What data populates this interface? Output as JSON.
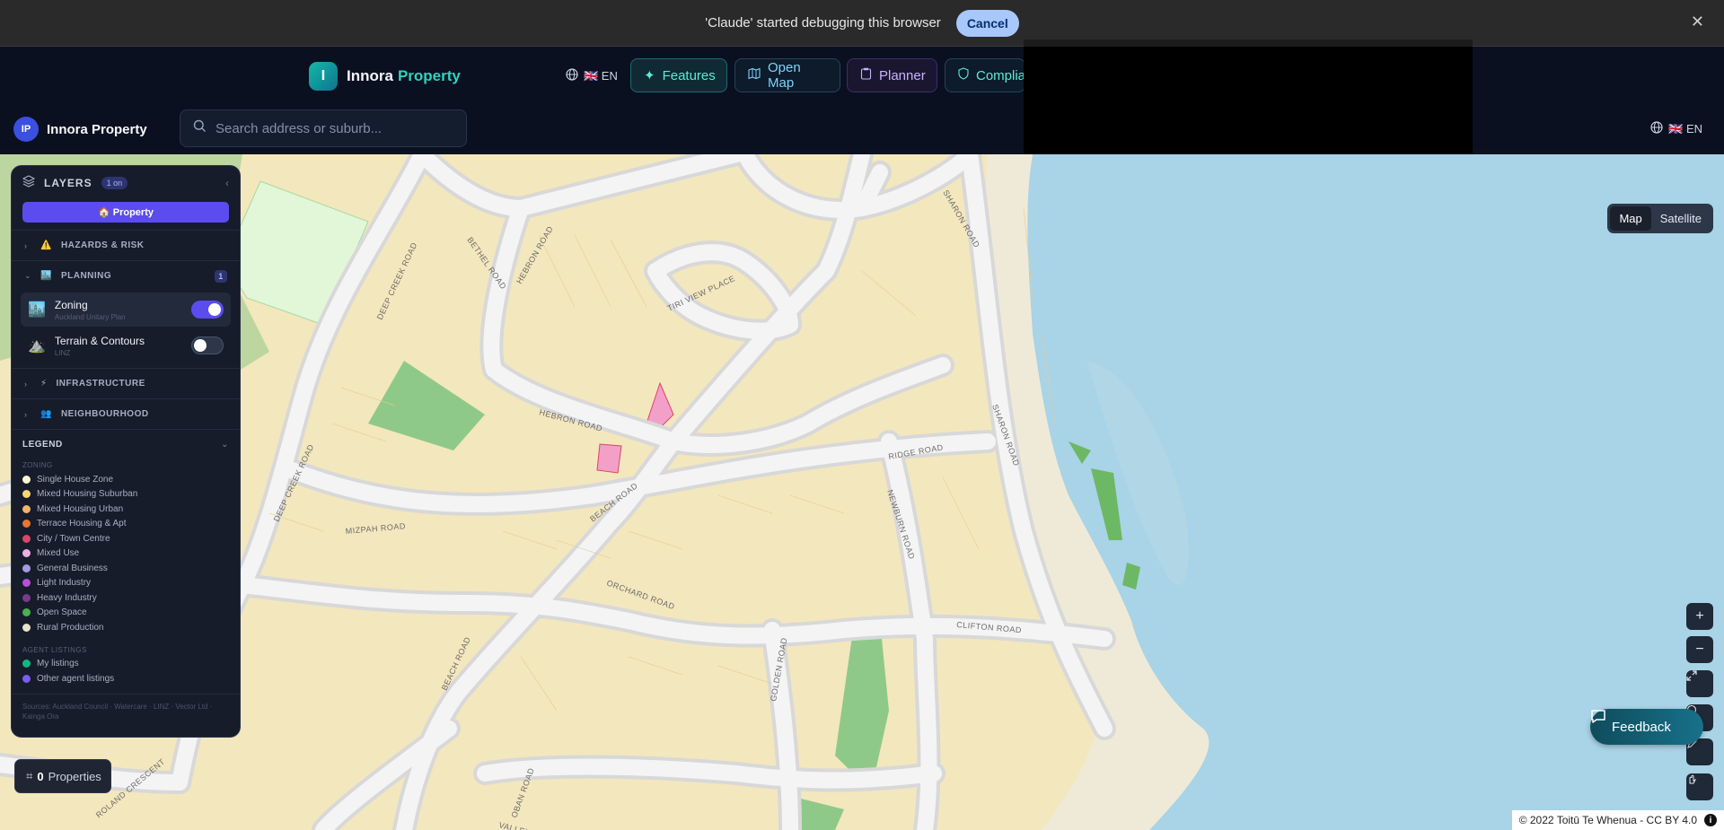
{
  "debug_banner": {
    "message": "'Claude' started debugging this browser",
    "cancel_label": "Cancel"
  },
  "topnav": {
    "logo_letter": "I",
    "brand_primary": "Innora",
    "brand_accent": "Property",
    "language": "🇬🇧 EN",
    "nav": {
      "features": "Features",
      "open_map": "Open Map",
      "planner": "Planner",
      "compliance": "Complia"
    }
  },
  "header": {
    "avatar_initials": "IP",
    "app_name": "Innora Property",
    "search_placeholder": "Search address or suburb...",
    "language": "🇬🇧 EN"
  },
  "layers_panel": {
    "title": "LAYERS",
    "active_count": "1 on",
    "property_button": "🏠 Property",
    "sections": {
      "hazards": "HAZARDS & RISK",
      "planning": "PLANNING",
      "planning_count": "1",
      "infrastructure": "INFRASTRUCTURE",
      "neighbourhood": "NEIGHBOURHOOD"
    },
    "layers": [
      {
        "name": "Zoning",
        "source": "Auckland Unitary Plan",
        "enabled": true
      },
      {
        "name": "Terrain & Contours",
        "source": "LINZ",
        "enabled": false
      }
    ],
    "legend": {
      "title": "LEGEND",
      "zoning_heading": "ZONING",
      "zoning": [
        {
          "label": "Single House Zone",
          "color": "#fdf6d3"
        },
        {
          "label": "Mixed Housing Suburban",
          "color": "#f7d774"
        },
        {
          "label": "Mixed Housing Urban",
          "color": "#f3b26b"
        },
        {
          "label": "Terrace Housing & Apt",
          "color": "#e8762f"
        },
        {
          "label": "City / Town Centre",
          "color": "#d9466a"
        },
        {
          "label": "Mixed Use",
          "color": "#e9b2e0"
        },
        {
          "label": "General Business",
          "color": "#a59adf"
        },
        {
          "label": "Light Industry",
          "color": "#b84fd9"
        },
        {
          "label": "Heavy Industry",
          "color": "#7a3b8e"
        },
        {
          "label": "Open Space",
          "color": "#4caf50"
        },
        {
          "label": "Rural Production",
          "color": "#e8e1d0"
        }
      ],
      "listings_heading": "AGENT LISTINGS",
      "listings": [
        {
          "label": "My listings",
          "color": "#10b981"
        },
        {
          "label": "Other agent listings",
          "color": "#7c5cf0"
        }
      ]
    },
    "sources": "Sources: Auckland Council · Watercare · LINZ · Vector Ltd · Kainga Ora"
  },
  "properties_chip": {
    "count": "0",
    "label": "Properties"
  },
  "map": {
    "view_toggle": {
      "map": "Map",
      "satellite": "Satellite",
      "selected": "Map"
    },
    "road_labels": [
      "SHARON ROAD",
      "BETHEL ROAD",
      "HEBRON ROAD",
      "TIRI VIEW PLACE",
      "DEEP CREEK ROAD",
      "HEBRON ROAD",
      "RIDGE ROAD",
      "SHARON ROAD",
      "BEACH ROAD",
      "MIZPAH ROAD",
      "NEWBURN ROAD",
      "ORCHARD ROAD",
      "CLIFTON ROAD",
      "BEACH ROAD",
      "GOLDEN ROAD",
      "OBAN ROAD",
      "ROLAND CRESCENT",
      "VALLEY",
      "DEEP CREEK ROAD"
    ],
    "colors": {
      "land": "#f3e7bd",
      "water": "#a9d3e6",
      "coast": "#efead8",
      "park": "#8fc98a",
      "road": "#e6e6e6"
    },
    "controls": [
      "zoom-in-icon",
      "zoom-out-icon",
      "fullscreen-icon",
      "draw-icon",
      "locate-icon"
    ],
    "attribution": "© 2022 Toitū Te Whenua - CC BY 4.0"
  },
  "feedback_label": "Feedback"
}
